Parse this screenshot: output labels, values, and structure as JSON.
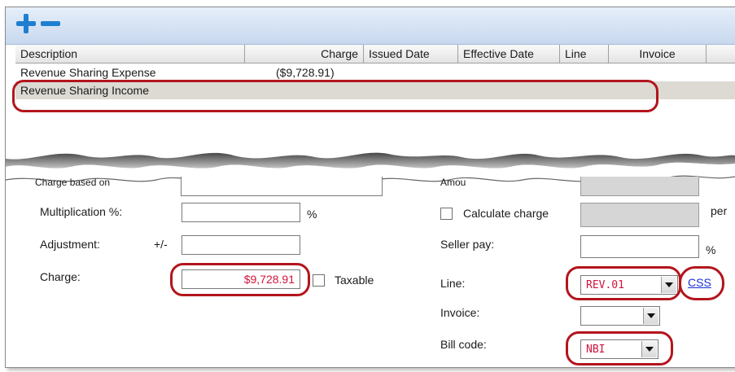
{
  "grid": {
    "columns": [
      "Description",
      "Charge",
      "Issued Date",
      "Effective Date",
      "Line",
      "Invoice"
    ],
    "rows": [
      {
        "description": "Revenue Sharing Expense",
        "charge": "($9,728.91)"
      },
      {
        "description": "Revenue Sharing Income",
        "charge": ""
      }
    ]
  },
  "form": {
    "charge_based_on_label": "Charge based on",
    "amount_label": "Amou",
    "multiplication_label": "Multiplication %:",
    "multiplication_value": "",
    "pct_symbol": "%",
    "calculate_charge_label": "Calculate charge",
    "per_label": "per",
    "adjustment_label": "Adjustment:",
    "plus_minus": "+/-",
    "adjustment_value": "",
    "seller_pay_label": "Seller pay:",
    "seller_pay_value": "",
    "charge_label": "Charge:",
    "charge_value": "$9,728.91",
    "taxable_label": "Taxable",
    "line_label": "Line:",
    "line_value": "REV.01",
    "css_link": "CSS",
    "invoice_label": "Invoice:",
    "invoice_value": "",
    "bill_code_label": "Bill code:",
    "bill_code_value": "NBI"
  },
  "colors": {
    "highlight": "#b3151d",
    "value_text": "#d0143c",
    "link": "#1a2fd6"
  },
  "icons": [
    "add-icon",
    "remove-icon",
    "dropdown-arrow-icon"
  ]
}
